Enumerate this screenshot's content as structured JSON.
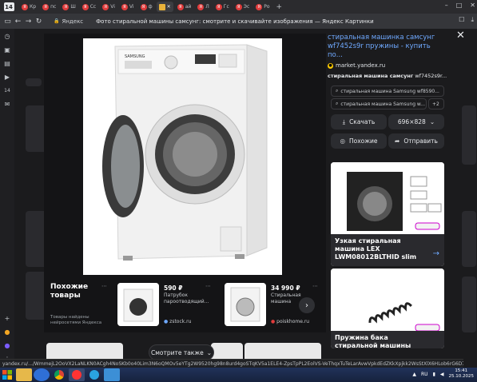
{
  "browser": {
    "tab_badge": "14",
    "tabs": [
      {
        "label": "Кр",
        "color": "#e03c3c"
      },
      {
        "label": "пс",
        "color": "#e03c3c"
      },
      {
        "label": "Ш",
        "color": "#e03c3c"
      },
      {
        "label": "Сс",
        "color": "#e03c3c"
      },
      {
        "label": "Vi",
        "color": "#e03c3c"
      },
      {
        "label": "Vi",
        "color": "#e03c3c"
      },
      {
        "label": "ф",
        "color": "#e03c3c"
      },
      {
        "label": "",
        "color": "#e8b23a",
        "active": true
      },
      {
        "label": "ай",
        "color": "#e03c3c"
      },
      {
        "label": "Л",
        "color": "#e03c3c"
      },
      {
        "label": "Гс",
        "color": "#e03c3c"
      },
      {
        "label": "Эс",
        "color": "#e03c3c"
      },
      {
        "label": "Ро",
        "color": "#e03c3c"
      }
    ],
    "address": {
      "brand": "Яндекс",
      "page_title": "Фото стиральной машины самсунг: смотрите и скачивайте изображения — Яндекс Картинки"
    },
    "status_url": "yandex.ru/.../WmmejL2OoVX2LaNLKN0ACgh4NoSKb0o40Lim3N6oQMOv5eYTg2W9520hg98n8urd4goSTqKV5a1ELE4-ZpsTpPL2EolVS-VeThqxTuTeLarAvwVpkdEdZKkXpjkk2WsStXlX6HLob6rG6D7ZY8e6KtTktZkM"
  },
  "viewer": {
    "title": "стиральная машинка самсунг wf7452s9r пружины - купить по...",
    "source": "market.yandex.ru",
    "description_bold": "стиральная машина самсунг",
    "description_rest": " wf7452s9r...",
    "queries": [
      "стиральная машина Samsung wf8590...",
      "стиральная машина Samsung w...",
      "+2"
    ],
    "download_label": "Скачать",
    "size_label": "696×828",
    "similar_label": "Похожие",
    "share_label": "Отправить",
    "cards": [
      {
        "caption": "Узкая стиральная машина LEX LWM08012BLTHID slim"
      },
      {
        "caption": "Пружина бака стиральной машины"
      }
    ]
  },
  "similar_products": {
    "title": "Похожие товары",
    "note": "Товары найдены нейросетями Яндекса",
    "items": [
      {
        "price": "590 ₽",
        "name": "Патрубок пароотводящий...",
        "shop": "zstock.ru"
      },
      {
        "price": "34 990 ₽",
        "name": "Стиральная машина Samsung...",
        "shop": "poiskhome.ru"
      }
    ]
  },
  "see_also_label": "Смотрите также",
  "taskbar": {
    "lang": "RU",
    "time": "15:41",
    "date": "25.10.2025"
  },
  "colors": {
    "accent_link": "#6fa9ff",
    "background": "#141416"
  }
}
